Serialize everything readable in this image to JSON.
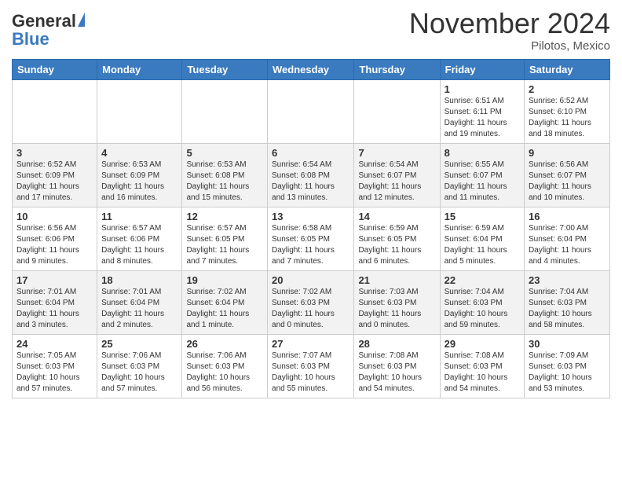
{
  "header": {
    "logo_line1": "General",
    "logo_line2": "Blue",
    "month": "November 2024",
    "location": "Pilotos, Mexico"
  },
  "weekdays": [
    "Sunday",
    "Monday",
    "Tuesday",
    "Wednesday",
    "Thursday",
    "Friday",
    "Saturday"
  ],
  "weeks": [
    [
      {
        "day": "",
        "info": ""
      },
      {
        "day": "",
        "info": ""
      },
      {
        "day": "",
        "info": ""
      },
      {
        "day": "",
        "info": ""
      },
      {
        "day": "",
        "info": ""
      },
      {
        "day": "1",
        "info": "Sunrise: 6:51 AM\nSunset: 6:11 PM\nDaylight: 11 hours\nand 19 minutes."
      },
      {
        "day": "2",
        "info": "Sunrise: 6:52 AM\nSunset: 6:10 PM\nDaylight: 11 hours\nand 18 minutes."
      }
    ],
    [
      {
        "day": "3",
        "info": "Sunrise: 6:52 AM\nSunset: 6:09 PM\nDaylight: 11 hours\nand 17 minutes."
      },
      {
        "day": "4",
        "info": "Sunrise: 6:53 AM\nSunset: 6:09 PM\nDaylight: 11 hours\nand 16 minutes."
      },
      {
        "day": "5",
        "info": "Sunrise: 6:53 AM\nSunset: 6:08 PM\nDaylight: 11 hours\nand 15 minutes."
      },
      {
        "day": "6",
        "info": "Sunrise: 6:54 AM\nSunset: 6:08 PM\nDaylight: 11 hours\nand 13 minutes."
      },
      {
        "day": "7",
        "info": "Sunrise: 6:54 AM\nSunset: 6:07 PM\nDaylight: 11 hours\nand 12 minutes."
      },
      {
        "day": "8",
        "info": "Sunrise: 6:55 AM\nSunset: 6:07 PM\nDaylight: 11 hours\nand 11 minutes."
      },
      {
        "day": "9",
        "info": "Sunrise: 6:56 AM\nSunset: 6:07 PM\nDaylight: 11 hours\nand 10 minutes."
      }
    ],
    [
      {
        "day": "10",
        "info": "Sunrise: 6:56 AM\nSunset: 6:06 PM\nDaylight: 11 hours\nand 9 minutes."
      },
      {
        "day": "11",
        "info": "Sunrise: 6:57 AM\nSunset: 6:06 PM\nDaylight: 11 hours\nand 8 minutes."
      },
      {
        "day": "12",
        "info": "Sunrise: 6:57 AM\nSunset: 6:05 PM\nDaylight: 11 hours\nand 7 minutes."
      },
      {
        "day": "13",
        "info": "Sunrise: 6:58 AM\nSunset: 6:05 PM\nDaylight: 11 hours\nand 7 minutes."
      },
      {
        "day": "14",
        "info": "Sunrise: 6:59 AM\nSunset: 6:05 PM\nDaylight: 11 hours\nand 6 minutes."
      },
      {
        "day": "15",
        "info": "Sunrise: 6:59 AM\nSunset: 6:04 PM\nDaylight: 11 hours\nand 5 minutes."
      },
      {
        "day": "16",
        "info": "Sunrise: 7:00 AM\nSunset: 6:04 PM\nDaylight: 11 hours\nand 4 minutes."
      }
    ],
    [
      {
        "day": "17",
        "info": "Sunrise: 7:01 AM\nSunset: 6:04 PM\nDaylight: 11 hours\nand 3 minutes."
      },
      {
        "day": "18",
        "info": "Sunrise: 7:01 AM\nSunset: 6:04 PM\nDaylight: 11 hours\nand 2 minutes."
      },
      {
        "day": "19",
        "info": "Sunrise: 7:02 AM\nSunset: 6:04 PM\nDaylight: 11 hours\nand 1 minute."
      },
      {
        "day": "20",
        "info": "Sunrise: 7:02 AM\nSunset: 6:03 PM\nDaylight: 11 hours\nand 0 minutes."
      },
      {
        "day": "21",
        "info": "Sunrise: 7:03 AM\nSunset: 6:03 PM\nDaylight: 11 hours\nand 0 minutes."
      },
      {
        "day": "22",
        "info": "Sunrise: 7:04 AM\nSunset: 6:03 PM\nDaylight: 10 hours\nand 59 minutes."
      },
      {
        "day": "23",
        "info": "Sunrise: 7:04 AM\nSunset: 6:03 PM\nDaylight: 10 hours\nand 58 minutes."
      }
    ],
    [
      {
        "day": "24",
        "info": "Sunrise: 7:05 AM\nSunset: 6:03 PM\nDaylight: 10 hours\nand 57 minutes."
      },
      {
        "day": "25",
        "info": "Sunrise: 7:06 AM\nSunset: 6:03 PM\nDaylight: 10 hours\nand 57 minutes."
      },
      {
        "day": "26",
        "info": "Sunrise: 7:06 AM\nSunset: 6:03 PM\nDaylight: 10 hours\nand 56 minutes."
      },
      {
        "day": "27",
        "info": "Sunrise: 7:07 AM\nSunset: 6:03 PM\nDaylight: 10 hours\nand 55 minutes."
      },
      {
        "day": "28",
        "info": "Sunrise: 7:08 AM\nSunset: 6:03 PM\nDaylight: 10 hours\nand 54 minutes."
      },
      {
        "day": "29",
        "info": "Sunrise: 7:08 AM\nSunset: 6:03 PM\nDaylight: 10 hours\nand 54 minutes."
      },
      {
        "day": "30",
        "info": "Sunrise: 7:09 AM\nSunset: 6:03 PM\nDaylight: 10 hours\nand 53 minutes."
      }
    ]
  ]
}
